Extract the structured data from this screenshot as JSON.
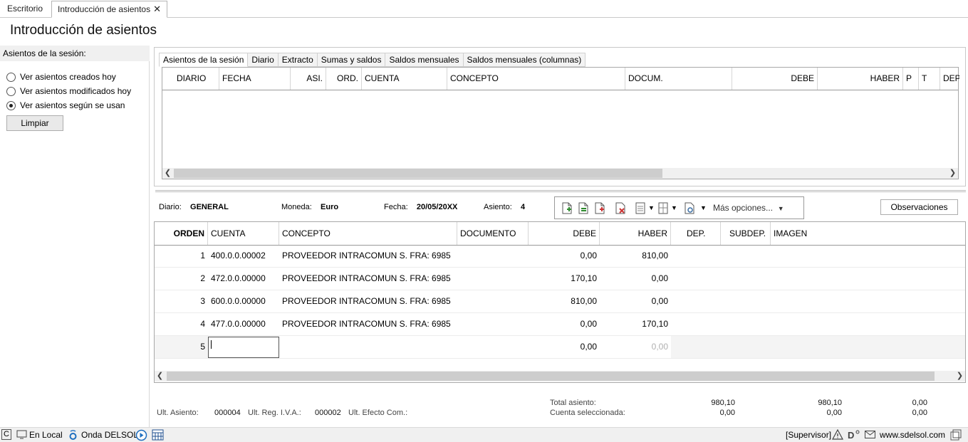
{
  "doc_tabs": [
    {
      "label": "Escritorio"
    },
    {
      "label": "Introducción de asientos",
      "close": "✕"
    }
  ],
  "page_title": "Introducción de asientos",
  "session": {
    "header": "Asientos de la sesión:",
    "options": [
      {
        "label": "Ver asientos creados hoy",
        "checked": false
      },
      {
        "label": "Ver asientos modificados hoy",
        "checked": false
      },
      {
        "label": "Ver asientos según se usan",
        "checked": true
      }
    ],
    "clear_button": "Limpiar"
  },
  "grid_tabs": [
    "Asientos de la sesión",
    "Diario",
    "Extracto",
    "Sumas y saldos",
    "Saldos mensuales",
    "Saldos mensuales (columnas)"
  ],
  "grid_columns": [
    "DIARIO",
    "FECHA",
    "ASI.",
    "ORD.",
    "CUENTA",
    "CONCEPTO",
    "DOCUM.",
    "DEBE",
    "HABER",
    "P",
    "T",
    "DEP."
  ],
  "entry": {
    "diario_label": "Diario:",
    "diario": "GENERAL",
    "moneda_label": "Moneda:",
    "moneda": "Euro",
    "fecha_label": "Fecha:",
    "fecha": "20/05/20XX",
    "asiento_label": "Asiento:",
    "asiento": "4"
  },
  "toolbar": {
    "more_options": "Más opciones...",
    "observations": "Observaciones"
  },
  "lines_columns": [
    "ORDEN",
    "CUENTA",
    "CONCEPTO",
    "DOCUMENTO",
    "DEBE",
    "HABER",
    "DEP.",
    "SUBDEP.",
    "IMAGEN"
  ],
  "lines": [
    {
      "orden": "1",
      "cuenta": "400.0.0.00002",
      "concepto": "PROVEEDOR INTRACOMUN S. FRA:  6985",
      "documento": "",
      "debe": "0,00",
      "haber": "810,00"
    },
    {
      "orden": "2",
      "cuenta": "472.0.0.00000",
      "concepto": "PROVEEDOR INTRACOMUN S. FRA:  6985",
      "documento": "",
      "debe": "170,10",
      "haber": "0,00"
    },
    {
      "orden": "3",
      "cuenta": "600.0.0.00000",
      "concepto": "PROVEEDOR INTRACOMUN S. FRA:  6985",
      "documento": "",
      "debe": "810,00",
      "haber": "0,00"
    },
    {
      "orden": "4",
      "cuenta": "477.0.0.00000",
      "concepto": "PROVEEDOR INTRACOMUN S. FRA:  6985",
      "documento": "",
      "debe": "0,00",
      "haber": "170,10"
    },
    {
      "orden": "5",
      "cuenta": "",
      "concepto": "",
      "documento": "",
      "debe": "0,00",
      "haber": "0,00"
    }
  ],
  "footer": {
    "ult_asiento_label": "Ult. Asiento:",
    "ult_asiento": "000004",
    "ult_reg_iva_label": "Ult. Reg. I.V.A.:",
    "ult_reg_iva": "000002",
    "ult_efecto_label": "Ult. Efecto Com.:",
    "total_label": "Total asiento:",
    "total_debe": "980,10",
    "total_haber": "980,10",
    "total_saldo": "0,00",
    "cuenta_label": "Cuenta seleccionada:",
    "cuenta_debe": "0,00",
    "cuenta_haber": "0,00",
    "cuenta_saldo": "0,00"
  },
  "statusbar": {
    "c": "C",
    "local": "En Local",
    "onda": "Onda DELSOL",
    "user": "[Supervisor]",
    "site": "www.sdelsol.com"
  },
  "colors": {
    "header_bg": "#f0f0f0",
    "border": "#a8a8a8",
    "scroll_thumb": "#cdcdcd"
  }
}
